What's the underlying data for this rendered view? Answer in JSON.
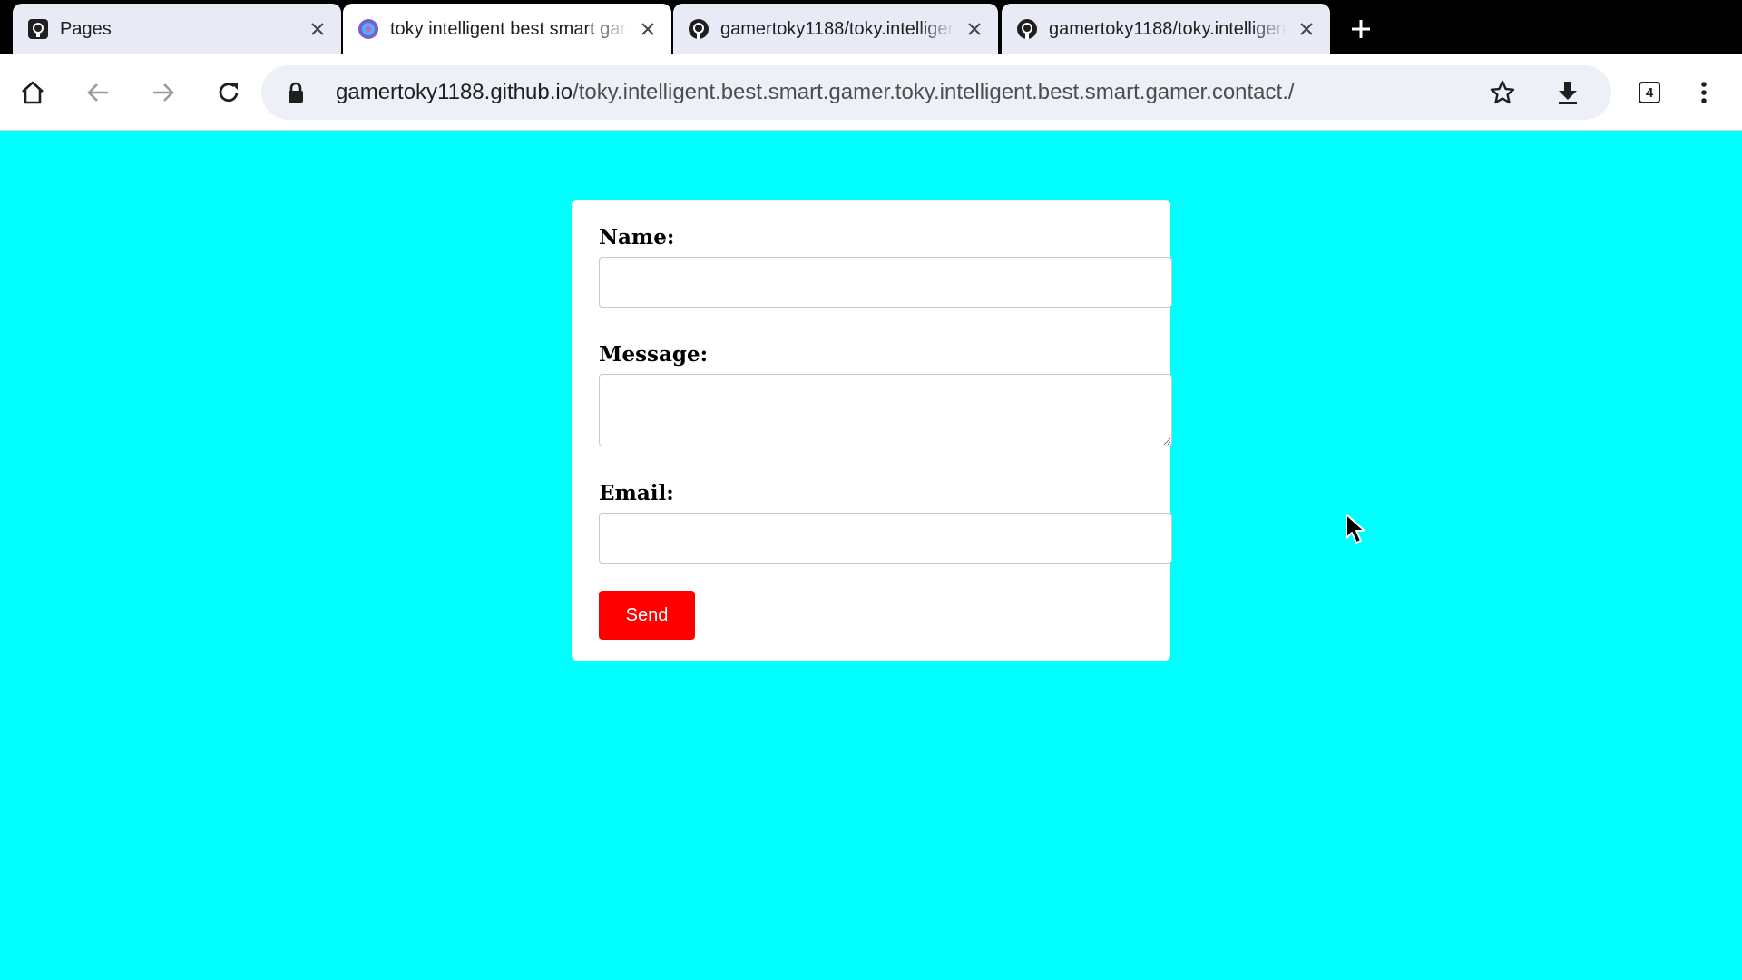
{
  "browser": {
    "tabs": [
      {
        "title": "Pages",
        "favicon": "github-icon",
        "active": false
      },
      {
        "title": "toky intelligent best smart gamer",
        "favicon": "site-avatar-icon",
        "active": true
      },
      {
        "title": "gamertoky1188/toky.intelligent",
        "favicon": "github-icon",
        "active": false
      },
      {
        "title": "gamertoky1188/toky.intelligent",
        "favicon": "github-icon",
        "active": false
      }
    ],
    "url_host": "gamertoky1188.github.io",
    "url_path": "/toky.intelligent.best.smart.gamer.toky.intelligent.best.smart.gamer.contact./",
    "tab_count": "4"
  },
  "form": {
    "name_label": "Name:",
    "name_value": "",
    "message_label": "Message:",
    "message_value": "",
    "email_label": "Email:",
    "email_value": "",
    "send_label": "Send"
  },
  "colors": {
    "page_background": "#00ffff",
    "send_button": "#ff0000",
    "card": "#ffffff"
  }
}
